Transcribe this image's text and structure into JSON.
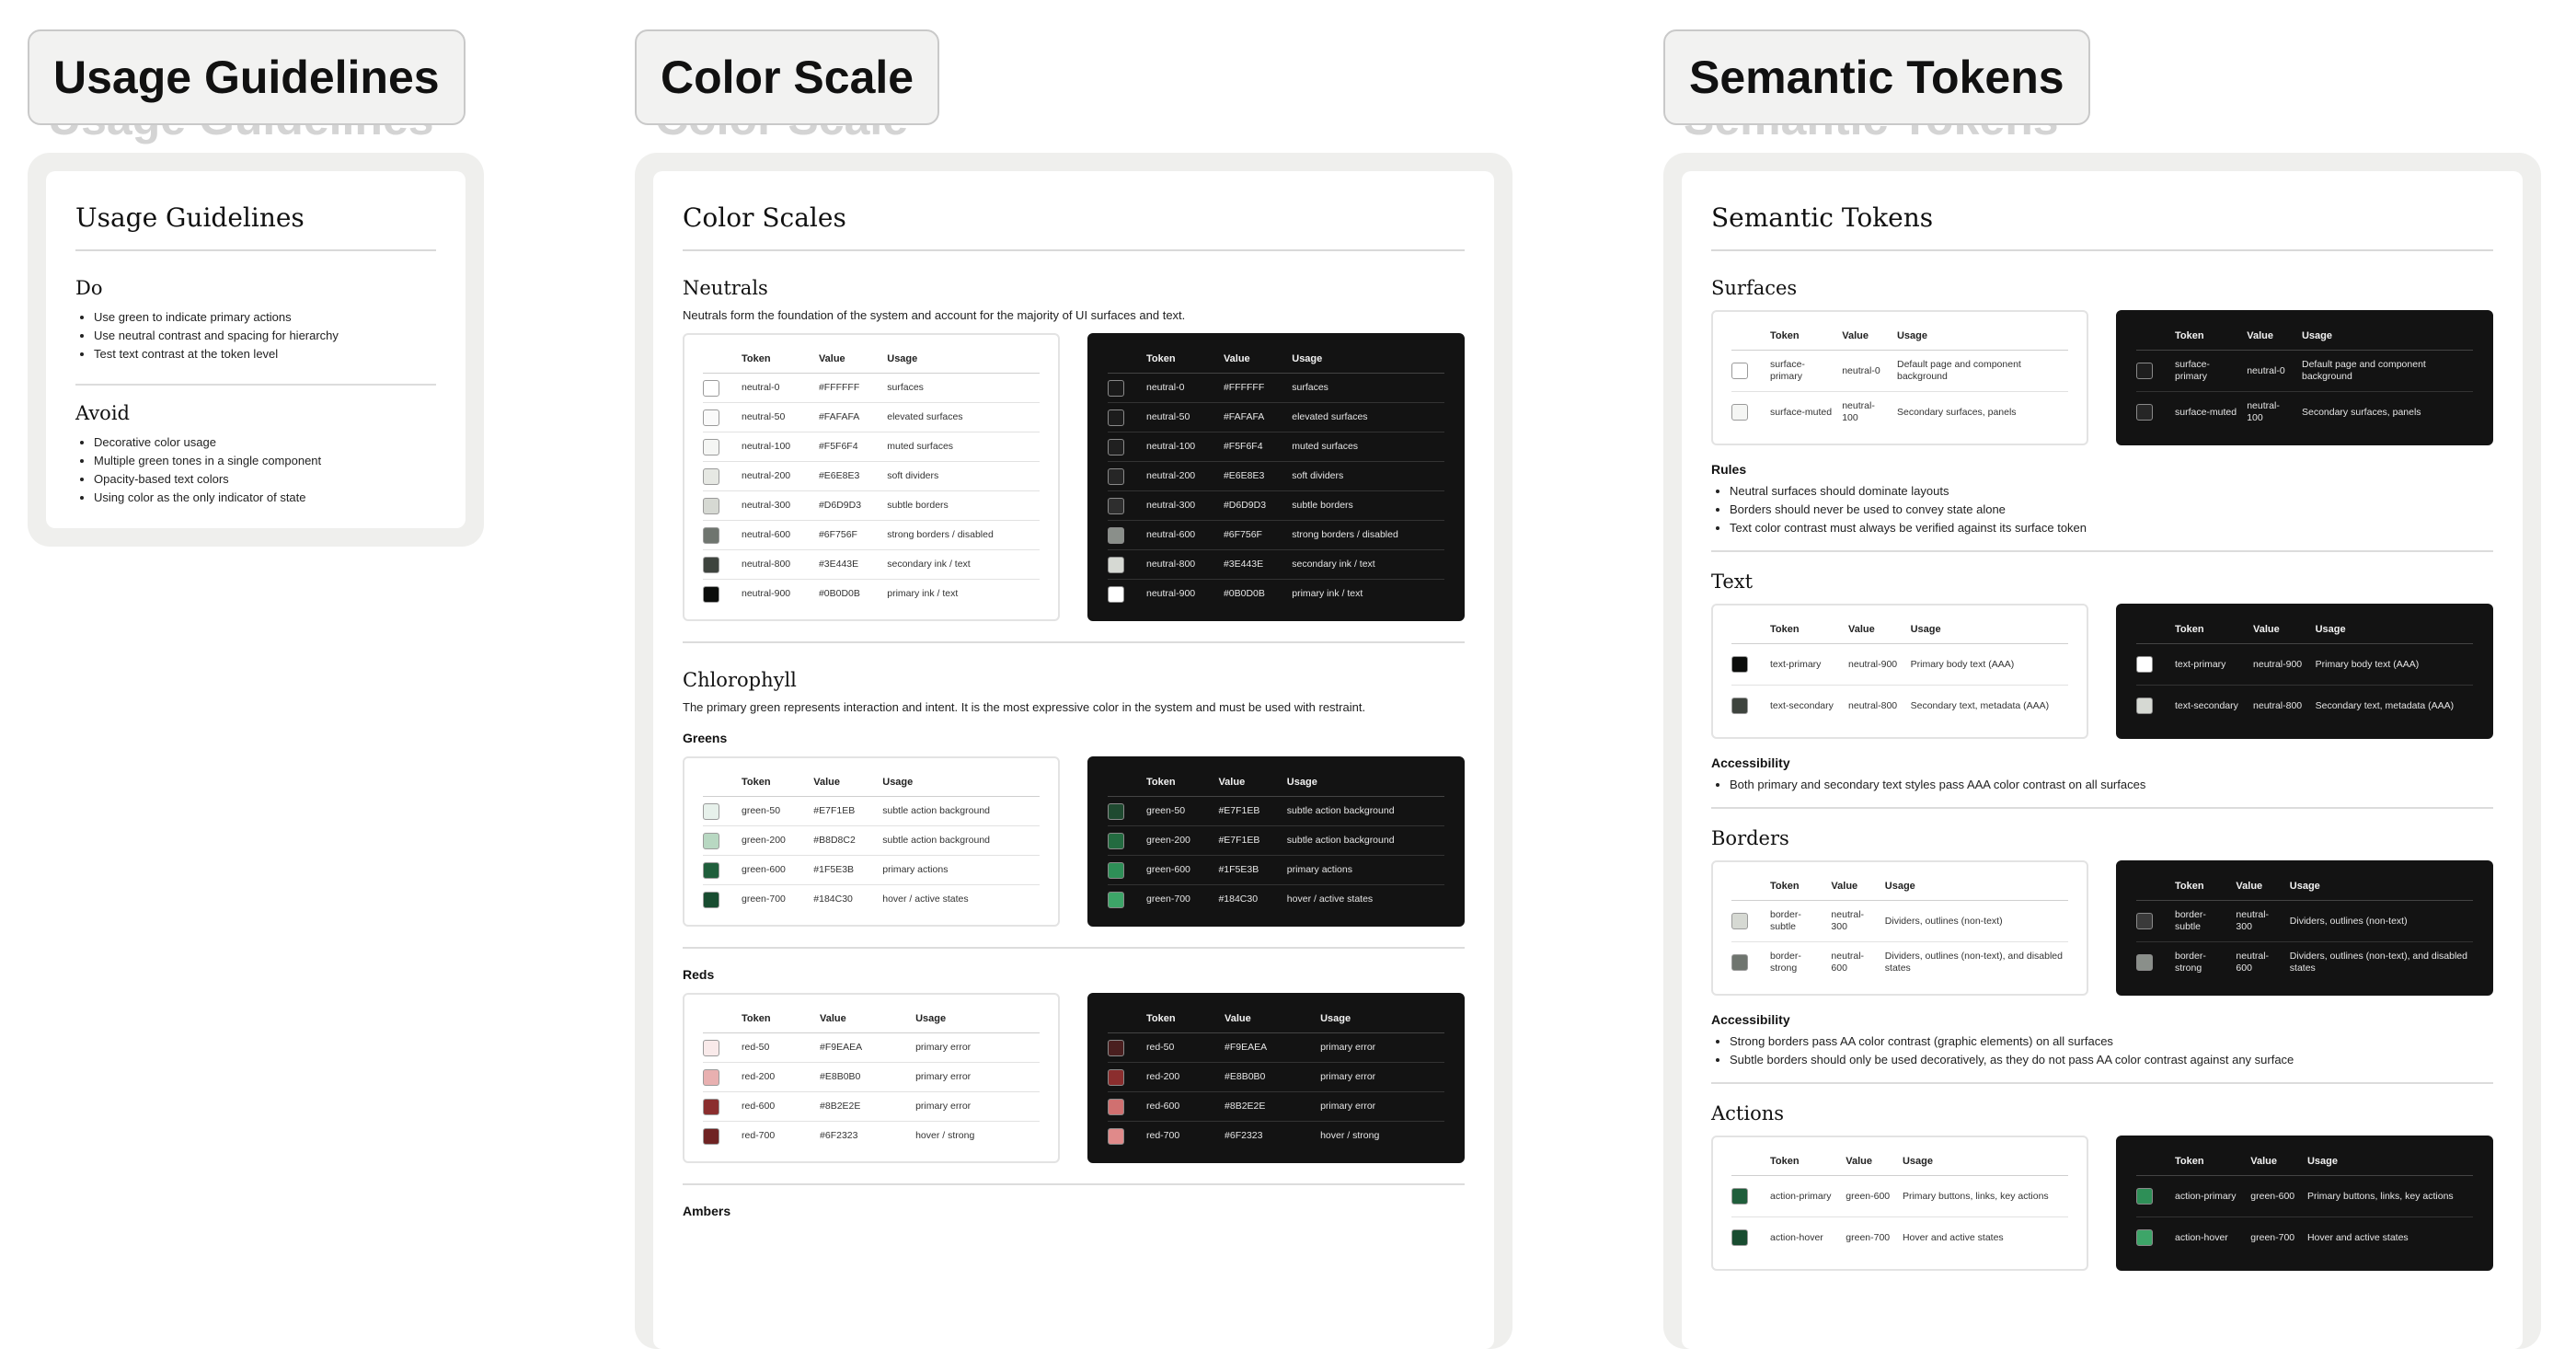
{
  "frames": {
    "usage": "Usage Guidelines",
    "color": "Color Scale",
    "semantic": "Semantic Tokens"
  },
  "usage": {
    "title": "Usage Guidelines",
    "do_heading": "Do",
    "do_items": [
      "Use green to indicate primary actions",
      "Use neutral contrast and spacing for hierarchy",
      "Test text contrast at the token level"
    ],
    "avoid_heading": "Avoid",
    "avoid_items": [
      "Decorative color usage",
      "Multiple green tones in a single component",
      "Opacity-based text colors",
      "Using color as the only indicator of state"
    ]
  },
  "color": {
    "title": "Color Scales",
    "headers": {
      "token": "Token",
      "value": "Value",
      "usage": "Usage"
    },
    "neutrals": {
      "heading": "Neutrals",
      "desc": "Neutrals form the foundation of the system and account for the majority of UI surfaces and text.",
      "rows": [
        {
          "token": "neutral-0",
          "value": "#FFFFFF",
          "usage": "surfaces",
          "color": "#FFFFFF"
        },
        {
          "token": "neutral-50",
          "value": "#FAFAFA",
          "usage": "elevated surfaces",
          "color": "#FAFAFA"
        },
        {
          "token": "neutral-100",
          "value": "#F5F6F4",
          "usage": "muted surfaces",
          "color": "#F5F6F4"
        },
        {
          "token": "neutral-200",
          "value": "#E6E8E3",
          "usage": "soft dividers",
          "color": "#E6E8E3"
        },
        {
          "token": "neutral-300",
          "value": "#D6D9D3",
          "usage": "subtle borders",
          "color": "#D6D9D3"
        },
        {
          "token": "neutral-600",
          "value": "#6F756F",
          "usage": "strong borders / disabled",
          "color": "#6F756F"
        },
        {
          "token": "neutral-800",
          "value": "#3E443E",
          "usage": "secondary ink / text",
          "color": "#3E443E"
        },
        {
          "token": "neutral-900",
          "value": "#0B0D0B",
          "usage": "primary ink / text",
          "color": "#0B0D0B"
        }
      ]
    },
    "chlorophyll": {
      "heading": "Chlorophyll",
      "desc": "The primary green represents interaction and intent. It is the most expressive color in the system and must be used with restraint.",
      "greens_heading": "Greens",
      "greens": [
        {
          "token": "green-50",
          "value": "#E7F1EB",
          "usage": "subtle action background",
          "color": "#E7F1EB"
        },
        {
          "token": "green-200",
          "value": "#B8D8C2",
          "usage": "subtle action background",
          "color": "#B8D8C2"
        },
        {
          "token": "green-600",
          "value": "#1F5E3B",
          "usage": "primary actions",
          "color": "#1F5E3B"
        },
        {
          "token": "green-700",
          "value": "#184C30",
          "usage": "hover / active states",
          "color": "#184C30"
        }
      ],
      "greens_dark": [
        {
          "token": "green-50",
          "value": "#E7F1EB",
          "usage": "subtle action background",
          "color": "#1F4A30"
        },
        {
          "token": "green-200",
          "value": "#E7F1EB",
          "usage": "subtle action background",
          "color": "#236B40"
        },
        {
          "token": "green-600",
          "value": "#1F5E3B",
          "usage": "primary actions",
          "color": "#2E8F57"
        },
        {
          "token": "green-700",
          "value": "#184C30",
          "usage": "hover / active states",
          "color": "#3DA568"
        }
      ],
      "reds_heading": "Reds",
      "reds": [
        {
          "token": "red-50",
          "value": "#F9EAEA",
          "usage": "primary error",
          "color": "#F9EAEA"
        },
        {
          "token": "red-200",
          "value": "#E8B0B0",
          "usage": "primary error",
          "color": "#E8B0B0"
        },
        {
          "token": "red-600",
          "value": "#8B2E2E",
          "usage": "primary error",
          "color": "#8B2E2E"
        },
        {
          "token": "red-700",
          "value": "#6F2323",
          "usage": "hover / strong",
          "color": "#6F2323"
        }
      ],
      "reds_dark": [
        {
          "token": "red-50",
          "value": "#F9EAEA",
          "usage": "primary error",
          "color": "#4A1F1F"
        },
        {
          "token": "red-200",
          "value": "#E8B0B0",
          "usage": "primary error",
          "color": "#8B2E2E"
        },
        {
          "token": "red-600",
          "value": "#8B2E2E",
          "usage": "primary error",
          "color": "#D07070"
        },
        {
          "token": "red-700",
          "value": "#6F2323",
          "usage": "hover / strong",
          "color": "#E08A8A"
        }
      ],
      "ambers_heading": "Ambers"
    }
  },
  "semantic": {
    "title": "Semantic Tokens",
    "headers": {
      "token": "Token",
      "value": "Value",
      "usage": "Usage"
    },
    "surfaces": {
      "heading": "Surfaces",
      "rows": [
        {
          "token": "surface-primary",
          "value": "neutral-0",
          "usage": "Default page and component background",
          "color": "#FFFFFF",
          "dark_color": "#1E1E1E"
        },
        {
          "token": "surface-muted",
          "value": "neutral-100",
          "usage": "Secondary surfaces, panels",
          "color": "#F5F6F4",
          "dark_color": "#262626"
        }
      ],
      "rules_heading": "Rules",
      "rules": [
        "Neutral surfaces should dominate layouts",
        "Borders should never be used to convey state alone",
        "Text color contrast must always be verified against its surface token"
      ]
    },
    "text": {
      "heading": "Text",
      "rows": [
        {
          "token": "text-primary",
          "value": "neutral-900",
          "usage": "Primary body text (AAA)",
          "color": "#0B0D0B",
          "dark_color": "#FFFFFF"
        },
        {
          "token": "text-secondary",
          "value": "neutral-800",
          "usage": "Secondary text, metadata (AAA)",
          "color": "#3E443E",
          "dark_color": "#D6D9D3"
        }
      ],
      "a11y_heading": "Accessibility",
      "a11y": [
        "Both primary and secondary text styles pass AAA color contrast on all surfaces"
      ]
    },
    "borders": {
      "heading": "Borders",
      "rows": [
        {
          "token": "border-subtle",
          "value": "neutral-300",
          "usage": "Dividers, outlines (non-text)",
          "color": "#D6D9D3",
          "dark_color": "#3A3A3A"
        },
        {
          "token": "border-strong",
          "value": "neutral-600",
          "usage": "Dividers, outlines (non-text), and disabled states",
          "color": "#6F756F",
          "dark_color": "#8A8F8A"
        }
      ],
      "a11y_heading": "Accessibility",
      "a11y": [
        "Strong borders pass AA color contrast (graphic elements) on all surfaces",
        "Subtle borders should only be used decoratively, as they do not pass AA color contrast against any surface"
      ]
    },
    "actions": {
      "heading": "Actions",
      "rows": [
        {
          "token": "action-primary",
          "value": "green-600",
          "usage": "Primary buttons, links, key actions",
          "color": "#1F5E3B",
          "dark_color": "#2E8F57"
        },
        {
          "token": "action-hover",
          "value": "green-700",
          "usage": "Hover and active states",
          "color": "#184C30",
          "dark_color": "#3DA568"
        }
      ]
    }
  }
}
